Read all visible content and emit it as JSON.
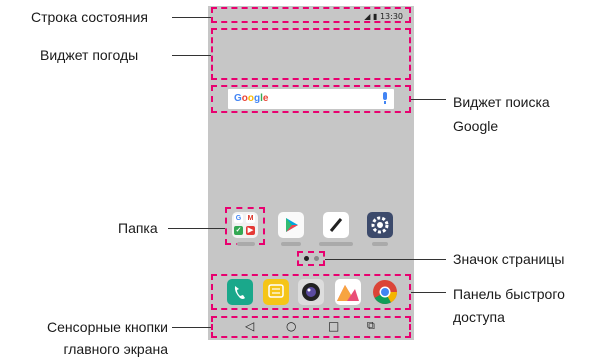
{
  "labels": {
    "status_bar": "Строка состояния",
    "weather_widget": "Виджет погоды",
    "folder": "Папка",
    "home_touch_buttons_line1": "Сенсорные кнопки",
    "home_touch_buttons_line2": "главного экрана",
    "google_search_widget_line1": "Виджет поиска",
    "google_search_widget_line2": "Google",
    "page_indicator": "Значок страницы",
    "quick_access_line1": "Панель быстрого",
    "quick_access_line2": "доступа"
  },
  "phone": {
    "status_time": "13:30",
    "search_logo": "Google",
    "accent_color": "#e8006f",
    "screen_color": "#c6c6c6"
  },
  "home_apps": [
    "folder-icon",
    "play-store-icon",
    "notes-icon",
    "settings-icon"
  ],
  "dock_apps": [
    "phone-icon",
    "messages-icon",
    "camera-icon",
    "gallery-icon",
    "chrome-icon"
  ],
  "nav_keys": {
    "back": "◁",
    "home": "○",
    "recents": "□",
    "dual_window": "⧉"
  }
}
